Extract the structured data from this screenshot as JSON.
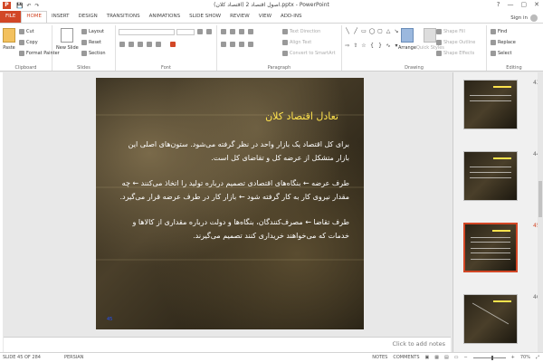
{
  "window": {
    "title": "اصول اقتصاد 2 (اقتصاد کلان).pptx - PowerPoint",
    "help": "?",
    "minimize": "—",
    "maximize": "▢",
    "close": "✕"
  },
  "qat": {
    "save": "💾",
    "undo": "↶",
    "redo": "↷"
  },
  "tabs": [
    "FILE",
    "HOME",
    "INSERT",
    "DESIGN",
    "TRANSITIONS",
    "ANIMATIONS",
    "SLIDE SHOW",
    "REVIEW",
    "VIEW",
    "ADD-INS"
  ],
  "signin": "Sign in",
  "ribbon": {
    "clipboard": {
      "label": "Clipboard",
      "paste": "Paste",
      "cut": "Cut",
      "copy": "Copy",
      "format_painter": "Format Painter"
    },
    "slides": {
      "label": "Slides",
      "new_slide": "New Slide",
      "layout": "Layout",
      "reset": "Reset",
      "section": "Section"
    },
    "font": {
      "label": "Font"
    },
    "paragraph": {
      "label": "Paragraph",
      "text_direction": "Text Direction",
      "align_text": "Align Text",
      "convert_smartart": "Convert to SmartArt"
    },
    "drawing": {
      "label": "Drawing",
      "arrange": "Arrange",
      "quick_styles": "Quick Styles",
      "shape_fill": "Shape Fill",
      "shape_outline": "Shape Outline",
      "shape_effects": "Shape Effects"
    },
    "editing": {
      "label": "Editing",
      "find": "Find",
      "replace": "Replace",
      "select": "Select"
    }
  },
  "slide": {
    "title": "تعادل اقتصاد کلان",
    "paragraphs": [
      "برای کل اقتصاد یک بازار واحد در نظر گرفته می‌شود. ستون‌های اصلی این بازار متشکل از عرضه کل و تقاضای کل است.",
      "طرف عرضه ← بنگاه‌های اقتصادی تصمیم درباره تولید را اتخاذ می‌کنند ← چه مقدار نیروی کار به کار گرفته شود ← بازار کار در طرف عرضه قرار می‌گیرد.",
      "طرف تقاضا ← مصرف‌کنندگان، بنگاه‌ها و دولت درباره مقداری از کالاها و خدمات که می‌خواهند خریداری کنند تصمیم می‌گیرند."
    ],
    "number": "45"
  },
  "notes_placeholder": "Click to add notes",
  "thumbnails": [
    {
      "num": "43"
    },
    {
      "num": "44"
    },
    {
      "num": "45"
    },
    {
      "num": "46"
    }
  ],
  "status": {
    "slide": "SLIDE 45 OF 284",
    "language": "PERSIAN",
    "notes": "NOTES",
    "comments": "COMMENTS",
    "zoom": "70%"
  }
}
